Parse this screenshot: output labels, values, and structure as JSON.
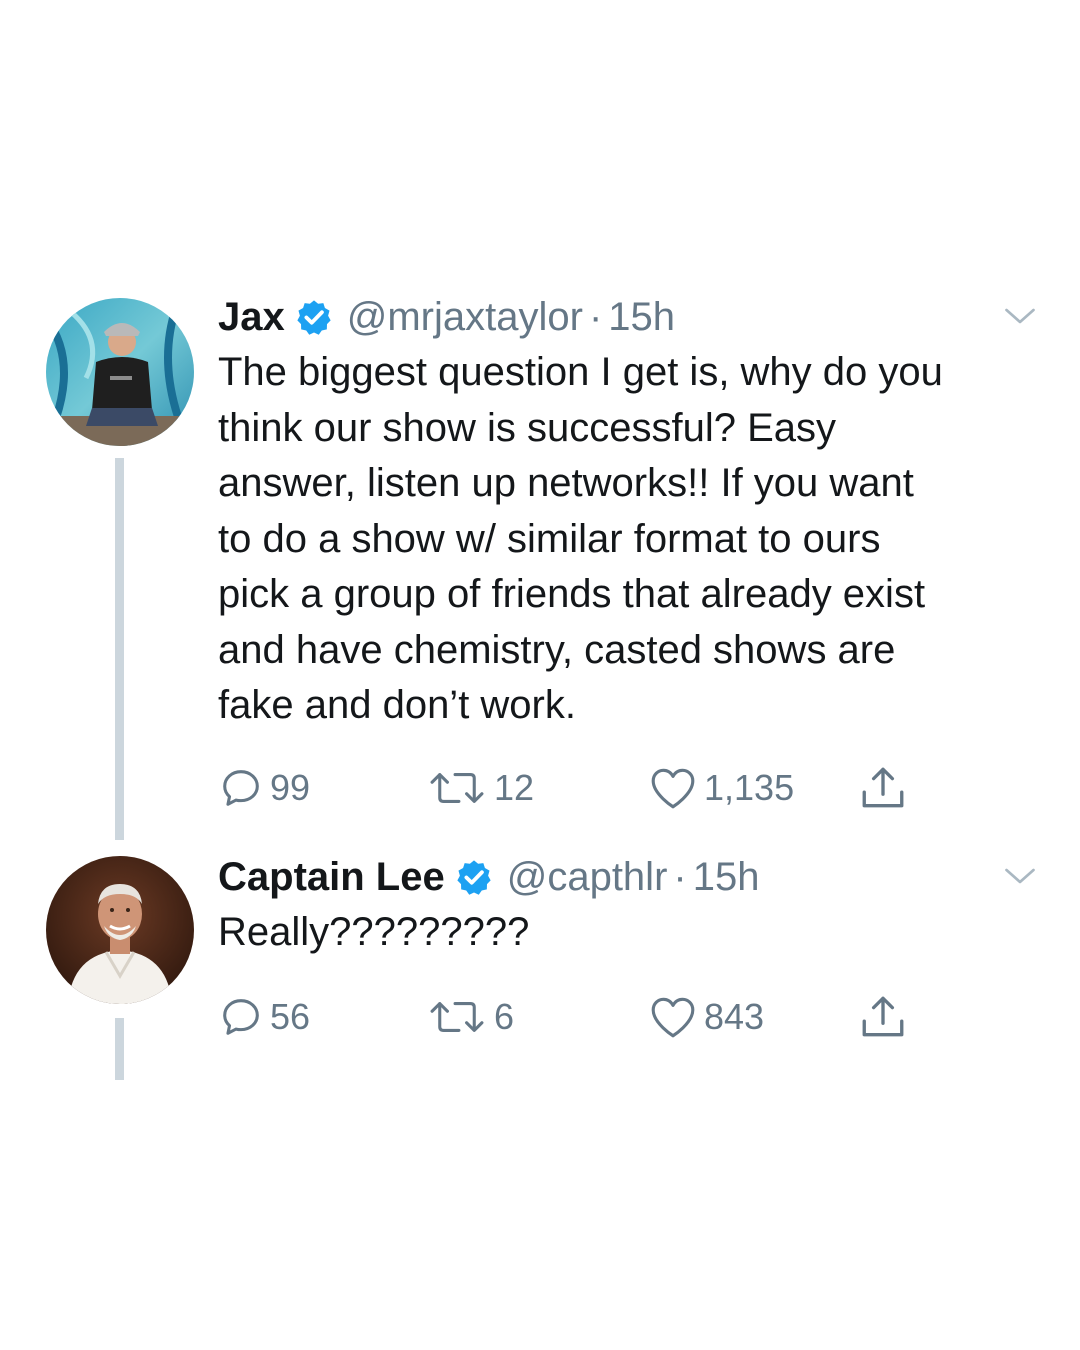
{
  "tweets": [
    {
      "name": "Jax",
      "handle": "@mrjaxtaylor",
      "dot": "·",
      "time": "15h",
      "text_lines": [
        "The biggest question I get is, why do you",
        "think our show is successful? Easy",
        "answer, listen up networks!! If you want",
        "to do a show w/ similar format to ours",
        "pick a group of friends that already exist",
        "and have chemistry, casted shows are",
        "fake and don’t work."
      ],
      "replies": "99",
      "retweets": "12",
      "likes": "1,135"
    },
    {
      "name": "Captain Lee",
      "handle": "@capthlr",
      "dot": "·",
      "time": "15h",
      "text_lines": [
        "Really?????????"
      ],
      "replies": "56",
      "retweets": "6",
      "likes": "843"
    }
  ],
  "icons": {
    "verified": "verified-badge-icon",
    "chevron": "chevron-down-icon",
    "reply": "reply-icon",
    "retweet": "retweet-icon",
    "like": "heart-icon",
    "share": "share-icon"
  },
  "colors": {
    "verified_blue": "#1da1f2",
    "secondary_text": "#657786",
    "thread_line": "#ccd6dd",
    "primary_text": "#14171a"
  }
}
